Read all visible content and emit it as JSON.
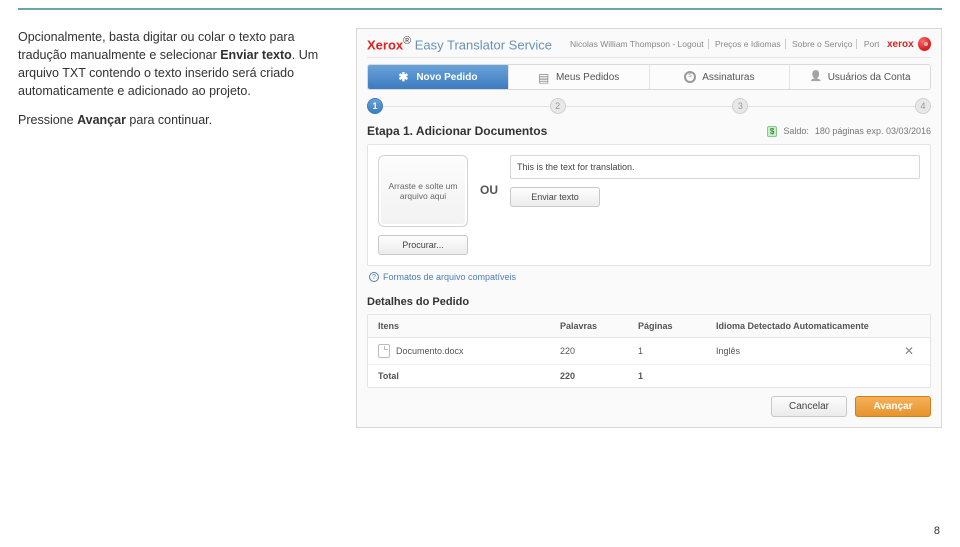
{
  "left": {
    "p1_prefix": "Opcionalmente, basta digitar ou colar o texto para tradução manualmente e selecionar ",
    "p1_bold": "Enviar texto",
    "p1_suffix": ". Um arquivo TXT contendo o texto inserido será criado automaticamente e adicionado ao projeto.",
    "p2_prefix": "Pressione ",
    "p2_bold": "Avançar",
    "p2_suffix": " para continuar."
  },
  "header": {
    "brand_xerox": "Xerox",
    "brand_sup": "®",
    "brand_sub": " Easy Translator Service",
    "links": [
      "Nicolas William Thompson - Logout",
      "Preços e Idiomas",
      "Sobre o Serviço",
      "Português"
    ],
    "logo_word": "xerox"
  },
  "tabs": [
    {
      "label": "Novo Pedido",
      "icon": "star-icon",
      "active": true
    },
    {
      "label": "Meus Pedidos",
      "icon": "doc-icon",
      "active": false
    },
    {
      "label": "Assinaturas",
      "icon": "coin-icon",
      "active": false
    },
    {
      "label": "Usuários da Conta",
      "icon": "user-icon",
      "active": false
    }
  ],
  "steps": [
    "1",
    "2",
    "3",
    "4"
  ],
  "step_title": "Etapa 1. Adicionar Documentos",
  "balance": {
    "badge": "$",
    "prefix": "Saldo: ",
    "value": "180 páginas exp. 03/03/2016"
  },
  "upload": {
    "dropzone": "Arraste e solte um arquivo aqui",
    "browse": "Procurar...",
    "ou": "OU",
    "textarea_text": "This is the text for translation.",
    "submit_text": "Enviar texto",
    "compatible": "Formatos de arquivo compatíveis"
  },
  "order": {
    "section": "Detalhes do Pedido",
    "headers": [
      "Itens",
      "Palavras",
      "Páginas",
      "Idioma Detectado Automaticamente"
    ],
    "row": {
      "name": "Documento.docx",
      "words": "220",
      "pages": "1",
      "lang": "Inglês"
    },
    "total_label": "Total",
    "total_words": "220",
    "total_pages": "1"
  },
  "buttons": {
    "cancel": "Cancelar",
    "next": "Avançar"
  },
  "page_number": "8"
}
